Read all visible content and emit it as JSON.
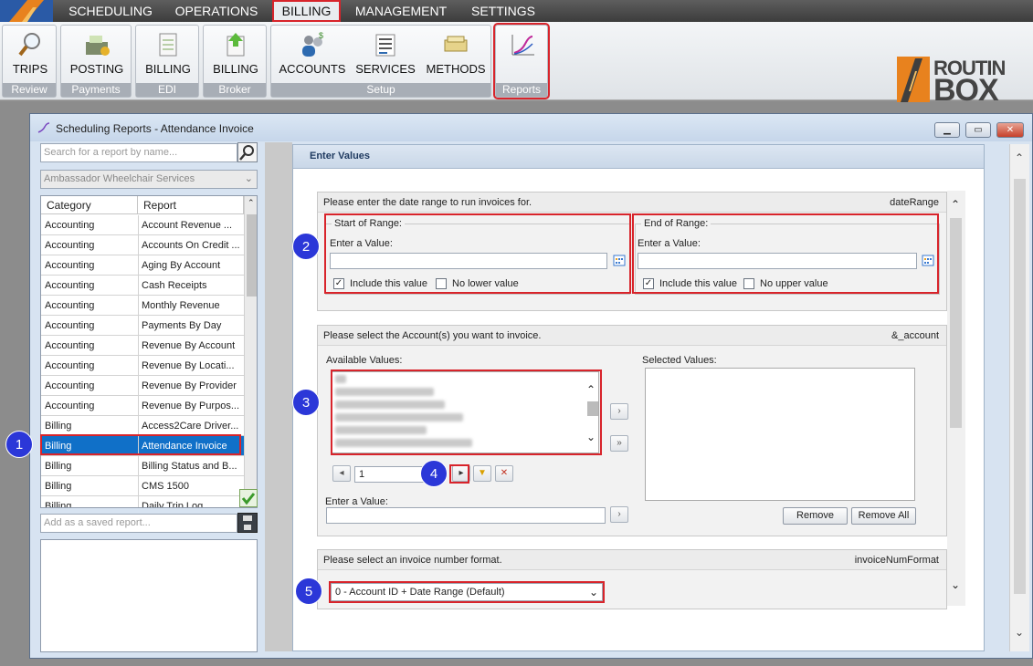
{
  "menu": {
    "items": [
      "SCHEDULING",
      "OPERATIONS",
      "BILLING",
      "MANAGEMENT",
      "SETTINGS"
    ],
    "selected": "BILLING"
  },
  "ribbon": {
    "groups": [
      {
        "name": "Review",
        "buttons": [
          "TRIPS"
        ]
      },
      {
        "name": "Payments",
        "buttons": [
          "POSTING"
        ]
      },
      {
        "name": "EDI",
        "buttons": [
          "BILLING"
        ]
      },
      {
        "name": "Broker",
        "buttons": [
          "BILLING"
        ]
      },
      {
        "name": "Setup",
        "buttons": [
          "ACCOUNTS",
          "SERVICES",
          "METHODS"
        ]
      },
      {
        "name": "Reports",
        "buttons": []
      }
    ]
  },
  "logo": {
    "line1": "ROUTIN",
    "line2": "BOX"
  },
  "window": {
    "title": "Scheduling Reports - Attendance Invoice"
  },
  "left": {
    "search_placeholder": "Search for a report by name...",
    "company": "Ambassador Wheelchair Services",
    "headers": [
      "Category",
      "Report"
    ],
    "rows": [
      [
        "Accounting",
        "Account Revenue ..."
      ],
      [
        "Accounting",
        "Accounts On Credit ..."
      ],
      [
        "Accounting",
        "Aging By Account"
      ],
      [
        "Accounting",
        "Cash Receipts"
      ],
      [
        "Accounting",
        "Monthly Revenue"
      ],
      [
        "Accounting",
        "Payments By Day"
      ],
      [
        "Accounting",
        "Revenue By Account"
      ],
      [
        "Accounting",
        "Revenue By Locati..."
      ],
      [
        "Accounting",
        "Revenue By Provider"
      ],
      [
        "Accounting",
        "Revenue By Purpos..."
      ],
      [
        "Billing",
        "Access2Care Driver..."
      ],
      [
        "Billing",
        "Attendance Invoice"
      ],
      [
        "Billing",
        "Billing Status and B..."
      ],
      [
        "Billing",
        "CMS 1500"
      ],
      [
        "Billing",
        "Daily Trip Log"
      ]
    ],
    "saved_placeholder": "Add as a saved report..."
  },
  "enter_values": {
    "title": "Enter Values",
    "date": {
      "prompt": "Please enter the date range to run invoices for.",
      "param": "dateRange",
      "start_title": "Start of Range:",
      "end_title": "End of Range:",
      "enter_label": "Enter a Value:",
      "include": "Include this value",
      "no_lower": "No lower value",
      "no_upper": "No upper value"
    },
    "account": {
      "prompt": "Please select the Account(s) you want to invoice.",
      "param": "&_account",
      "available": "Available Values:",
      "selected": "Selected Values:",
      "page": "1",
      "enter_label": "Enter a Value:",
      "remove": "Remove",
      "remove_all": "Remove All"
    },
    "invoice": {
      "prompt": "Please select an invoice number format.",
      "param": "invoiceNumFormat",
      "value": "0 - Account ID + Date Range (Default)"
    }
  },
  "badges": [
    "1",
    "2",
    "3",
    "4",
    "5"
  ],
  "colors": {
    "accent_red": "#d8242b",
    "badge_blue": "#2b37d8",
    "selection_blue": "#1070c8",
    "logo_orange": "#e8821e"
  }
}
